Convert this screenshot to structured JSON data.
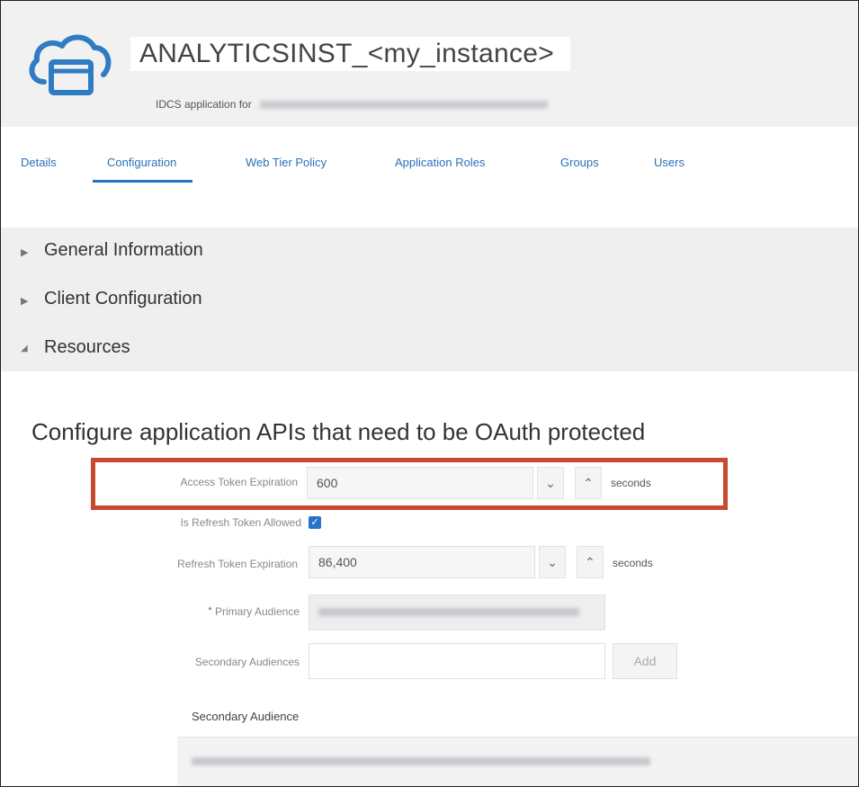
{
  "header": {
    "title": "ANALYTICSINST_<my_instance>",
    "subtitle_prefix": "IDCS application for"
  },
  "tabs": [
    {
      "label": "Details"
    },
    {
      "label": "Configuration"
    },
    {
      "label": "Web Tier Policy"
    },
    {
      "label": "Application Roles"
    },
    {
      "label": "Groups"
    },
    {
      "label": "Users"
    }
  ],
  "sections": {
    "general": "General Information",
    "client": "Client Configuration",
    "resources": "Resources"
  },
  "resources": {
    "title": "Configure application APIs that need to be OAuth protected",
    "access_token_label": "Access Token Expiration",
    "access_token_value": "600",
    "access_token_unit": "seconds",
    "refresh_allowed_label": "Is Refresh Token Allowed",
    "refresh_allowed_checked": true,
    "refresh_token_label": "Refresh Token Expiration",
    "refresh_token_value": "86,400",
    "refresh_token_unit": "seconds",
    "primary_audience_label": "Primary Audience",
    "required_marker": "*",
    "secondary_audiences_label": "Secondary Audiences",
    "add_label": "Add",
    "table_header": "Secondary Audience"
  },
  "icons": {
    "stepper_down": "chevron-down-icon",
    "stepper_up": "chevron-up-icon",
    "expand": "triangle-right-icon",
    "collapse": "triangle-down-icon",
    "checkbox": "check-icon"
  },
  "colors": {
    "accent": "#2a72b8",
    "highlight": "#c8492f",
    "checkbox": "#2a72c8"
  }
}
